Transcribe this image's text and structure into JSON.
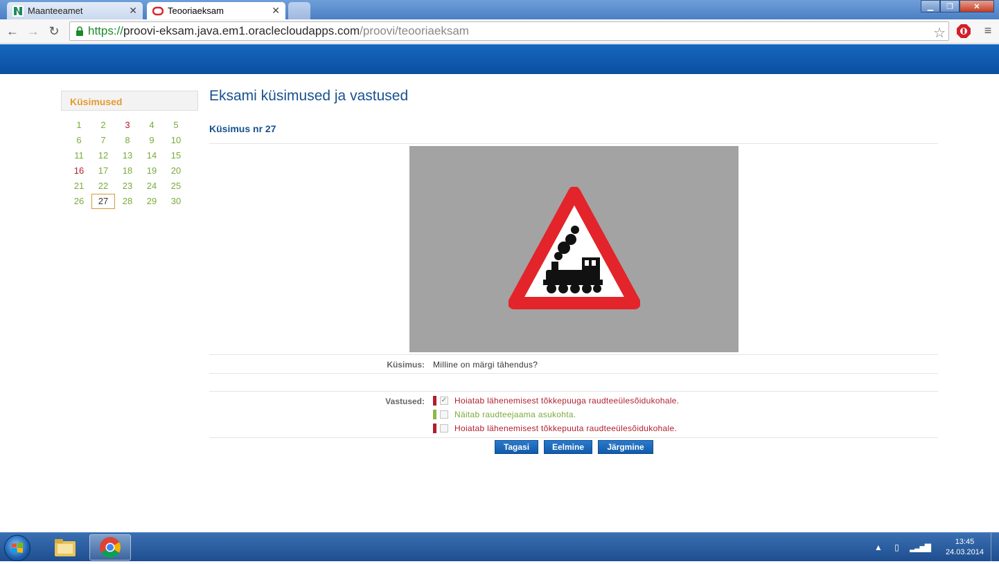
{
  "browser": {
    "tabs": [
      {
        "title": "Maanteeamet",
        "active": false
      },
      {
        "title": "Teooriaeksam",
        "active": true
      }
    ],
    "url_scheme": "https://",
    "url_host": "proovi-eksam.java.em1.oraclecloudapps.com",
    "url_path": "/proovi/teooriaeksam"
  },
  "sidebar": {
    "title": "Küsimused",
    "questions": [
      {
        "n": "1",
        "state": "correct"
      },
      {
        "n": "2",
        "state": "correct"
      },
      {
        "n": "3",
        "state": "wrong"
      },
      {
        "n": "4",
        "state": "correct"
      },
      {
        "n": "5",
        "state": "correct"
      },
      {
        "n": "6",
        "state": "correct"
      },
      {
        "n": "7",
        "state": "correct"
      },
      {
        "n": "8",
        "state": "correct"
      },
      {
        "n": "9",
        "state": "correct"
      },
      {
        "n": "10",
        "state": "correct"
      },
      {
        "n": "11",
        "state": "correct"
      },
      {
        "n": "12",
        "state": "correct"
      },
      {
        "n": "13",
        "state": "correct"
      },
      {
        "n": "14",
        "state": "correct"
      },
      {
        "n": "15",
        "state": "correct"
      },
      {
        "n": "16",
        "state": "wrong"
      },
      {
        "n": "17",
        "state": "correct"
      },
      {
        "n": "18",
        "state": "correct"
      },
      {
        "n": "19",
        "state": "correct"
      },
      {
        "n": "20",
        "state": "correct"
      },
      {
        "n": "21",
        "state": "correct"
      },
      {
        "n": "22",
        "state": "correct"
      },
      {
        "n": "23",
        "state": "correct"
      },
      {
        "n": "24",
        "state": "correct"
      },
      {
        "n": "25",
        "state": "correct"
      },
      {
        "n": "26",
        "state": "correct"
      },
      {
        "n": "27",
        "state": "current"
      },
      {
        "n": "28",
        "state": "correct"
      },
      {
        "n": "29",
        "state": "correct"
      },
      {
        "n": "30",
        "state": "correct"
      }
    ]
  },
  "main": {
    "title": "Eksami küsimused ja vastused",
    "question_heading": "Küsimus nr 27",
    "question_label": "Küsimus:",
    "question_text": "Milline on märgi tähendus?",
    "answers_label": "Vastused:",
    "answers": [
      {
        "text": "Hoiatab lähenemisest tõkkepuuga raudteeülesõidukohale.",
        "checked": true,
        "bar_color": "#b01e2e",
        "text_color": "#b01e2e"
      },
      {
        "text": "Näitab raudteejaama asukohta.",
        "checked": false,
        "bar_color": "#8bb84a",
        "text_color": "#7aaa3a"
      },
      {
        "text": "Hoiatab lähenemisest tõkkepuuta raudteeülesõidukohale.",
        "checked": false,
        "bar_color": "#b01e2e",
        "text_color": "#b01e2e"
      }
    ],
    "buttons": {
      "back": "Tagasi",
      "prev": "Eelmine",
      "next": "Järgmine"
    }
  },
  "taskbar": {
    "time": "13:45",
    "date": "24.03.2014"
  },
  "colors": {
    "accent_blue": "#17518f",
    "correct_green": "#7aaa3a",
    "wrong_red": "#b01e2e",
    "sidebar_title_orange": "#e69a2f"
  }
}
